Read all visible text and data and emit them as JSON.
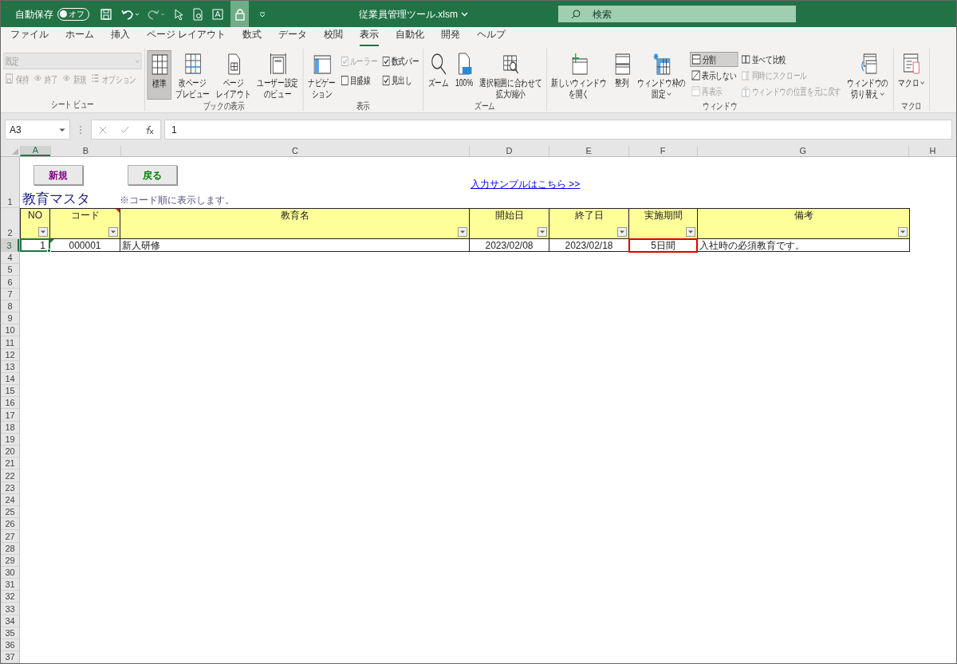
{
  "title_bar": {
    "autosave_label": "自動保存",
    "autosave_toggle": {
      "label": "オフ",
      "on": false
    },
    "filename": "従業員管理ツール.xlsm",
    "search": {
      "placeholder": "検索"
    }
  },
  "ribbon_tabs": [
    {
      "label": "ファイル",
      "selected": false
    },
    {
      "label": "ホーム",
      "selected": false
    },
    {
      "label": "挿入",
      "selected": false
    },
    {
      "label": "ページ レイアウト",
      "selected": false
    },
    {
      "label": "数式",
      "selected": false
    },
    {
      "label": "データ",
      "selected": false
    },
    {
      "label": "校閲",
      "selected": false
    },
    {
      "label": "表示",
      "selected": true
    },
    {
      "label": "自動化",
      "selected": false
    },
    {
      "label": "開発",
      "selected": false
    },
    {
      "label": "ヘルプ",
      "selected": false
    }
  ],
  "ribbon_groups": [
    {
      "label": "シート ビュー",
      "kind": "rows",
      "rows": [
        [
          {
            "kind": "dropdown",
            "value": "既定",
            "disabled": true
          }
        ],
        [
          {
            "kind": "small",
            "label": "保持",
            "disabled": true,
            "pressed": false
          },
          {
            "kind": "small",
            "label": "終了",
            "disabled": true,
            "pressed": false
          },
          {
            "kind": "small",
            "label": "新規",
            "disabled": true,
            "pressed": false
          },
          {
            "kind": "small",
            "label": "オプション",
            "disabled": true,
            "pressed": false
          }
        ]
      ]
    },
    {
      "label": "ブックの表示",
      "kind": "columns",
      "columns": [
        [
          {
            "kind": "large",
            "label_lines": [
              "標準"
            ],
            "pressed": true,
            "caret": false
          }
        ],
        [
          {
            "kind": "large",
            "label_lines": [
              "改ページ",
              "プレビュー"
            ],
            "pressed": false,
            "caret": false
          }
        ],
        [
          {
            "kind": "large",
            "label_lines": [
              "ページ",
              "レイアウト"
            ],
            "pressed": false,
            "caret": false
          }
        ],
        [
          {
            "kind": "large",
            "label_lines": [
              "ユーザー設定",
              "のビュー"
            ],
            "pressed": false,
            "caret": false
          }
        ]
      ]
    },
    {
      "label": "表示",
      "kind": "columns",
      "columns": [
        [
          {
            "kind": "large",
            "label_lines": [
              "ナビゲー",
              "ション"
            ],
            "pressed": false,
            "caret": false
          }
        ],
        [
          {
            "kind": "checkbox",
            "label": "ルーラー",
            "checked": true,
            "disabled": true
          },
          {
            "kind": "checkbox",
            "label": "目盛線",
            "checked": false,
            "disabled": false
          }
        ],
        [
          {
            "kind": "checkbox",
            "label": "数式バー",
            "checked": true,
            "disabled": false
          },
          {
            "kind": "checkbox",
            "label": "見出し",
            "checked": true,
            "disabled": false
          }
        ]
      ]
    },
    {
      "label": "ズーム",
      "kind": "columns",
      "columns": [
        [
          {
            "kind": "large",
            "label_lines": [
              "ズーム"
            ],
            "pressed": false,
            "caret": false
          }
        ],
        [
          {
            "kind": "large",
            "label_lines": [
              "100%"
            ],
            "pressed": false,
            "caret": false
          }
        ],
        [
          {
            "kind": "large",
            "label_lines": [
              "選択範囲に合わせて",
              "拡大/縮小"
            ],
            "pressed": false,
            "caret": false
          }
        ]
      ]
    },
    {
      "label": "ウィンドウ",
      "kind": "columns",
      "columns": [
        [
          {
            "kind": "large",
            "label_lines": [
              "新しいウィンドウ",
              "を開く"
            ],
            "pressed": false,
            "caret": false
          }
        ],
        [
          {
            "kind": "large",
            "label_lines": [
              "整列"
            ],
            "pressed": false,
            "caret": false
          }
        ],
        [
          {
            "kind": "large",
            "label_lines": [
              "ウィンドウ枠の",
              "固定"
            ],
            "pressed": false,
            "caret": true
          }
        ],
        [
          {
            "kind": "small",
            "label": "分割",
            "disabled": false,
            "pressed": true
          },
          {
            "kind": "small",
            "label": "表示しない",
            "disabled": false,
            "pressed": false
          },
          {
            "kind": "small",
            "label": "再表示",
            "disabled": true,
            "pressed": false
          }
        ],
        [
          {
            "kind": "small",
            "label": "並べて比較",
            "disabled": false,
            "pressed": false
          },
          {
            "kind": "small",
            "label": "同時にスクロール",
            "disabled": true,
            "pressed": false
          },
          {
            "kind": "small",
            "label": "ウィンドウの位置を元に戻す",
            "disabled": true,
            "pressed": false
          }
        ],
        [
          {
            "kind": "large",
            "label_lines": [
              "ウィンドウの",
              "切り替え"
            ],
            "pressed": false,
            "caret": true
          }
        ]
      ]
    },
    {
      "label": "マクロ",
      "kind": "columns",
      "columns": [
        [
          {
            "kind": "large",
            "label_lines": [
              "マクロ"
            ],
            "pressed": false,
            "caret": true
          }
        ]
      ]
    }
  ],
  "formula_bar": {
    "name_box": "A3",
    "formula": "1"
  },
  "column_headers": [
    {
      "label": "A",
      "selected": true
    },
    {
      "label": "B",
      "selected": false
    },
    {
      "label": "C",
      "selected": false
    },
    {
      "label": "D",
      "selected": false
    },
    {
      "label": "E",
      "selected": false
    },
    {
      "label": "F",
      "selected": false
    },
    {
      "label": "G",
      "selected": false
    },
    {
      "label": "H",
      "selected": false
    }
  ],
  "row_numbers": [
    {
      "label": "1",
      "selected": false
    },
    {
      "label": "2",
      "selected": false
    },
    {
      "label": "3",
      "selected": true
    },
    {
      "label": "4",
      "selected": false
    },
    {
      "label": "5",
      "selected": false
    },
    {
      "label": "6",
      "selected": false
    },
    {
      "label": "7",
      "selected": false
    },
    {
      "label": "8",
      "selected": false
    },
    {
      "label": "9",
      "selected": false
    },
    {
      "label": "10",
      "selected": false
    },
    {
      "label": "11",
      "selected": false
    },
    {
      "label": "12",
      "selected": false
    },
    {
      "label": "13",
      "selected": false
    },
    {
      "label": "14",
      "selected": false
    },
    {
      "label": "15",
      "selected": false
    },
    {
      "label": "16",
      "selected": false
    },
    {
      "label": "17",
      "selected": false
    },
    {
      "label": "18",
      "selected": false
    },
    {
      "label": "19",
      "selected": false
    },
    {
      "label": "20",
      "selected": false
    },
    {
      "label": "21",
      "selected": false
    },
    {
      "label": "22",
      "selected": false
    },
    {
      "label": "23",
      "selected": false
    },
    {
      "label": "24",
      "selected": false
    },
    {
      "label": "25",
      "selected": false
    },
    {
      "label": "26",
      "selected": false
    },
    {
      "label": "27",
      "selected": false
    },
    {
      "label": "28",
      "selected": false
    },
    {
      "label": "29",
      "selected": false
    },
    {
      "label": "30",
      "selected": false
    },
    {
      "label": "31",
      "selected": false
    },
    {
      "label": "32",
      "selected": false
    },
    {
      "label": "33",
      "selected": false
    },
    {
      "label": "34",
      "selected": false
    },
    {
      "label": "35",
      "selected": false
    },
    {
      "label": "36",
      "selected": false
    },
    {
      "label": "37",
      "selected": false
    }
  ],
  "sheet": {
    "buttons": [
      {
        "label": "新規",
        "color": "#800080"
      },
      {
        "label": "戻る",
        "color": "#008000"
      }
    ],
    "link": "入力サンプルはこちら >>",
    "title": "教育マスタ",
    "note": "※コード順に表示します。",
    "table": {
      "headers": [
        {
          "label": "NO",
          "comment": false
        },
        {
          "label": "コード",
          "comment": true
        },
        {
          "label": "教育名",
          "comment": false
        },
        {
          "label": "開始日",
          "comment": false
        },
        {
          "label": "終了日",
          "comment": false
        },
        {
          "label": "実施期間",
          "comment": false
        },
        {
          "label": "備考",
          "comment": false
        }
      ],
      "rows": [
        [
          {
            "text": "1",
            "selected": true,
            "flagged": false,
            "outlined": false
          },
          {
            "text": "000001",
            "selected": false,
            "flagged": true,
            "outlined": false
          },
          {
            "text": "新人研修",
            "selected": false,
            "flagged": false,
            "outlined": false
          },
          {
            "text": "2023/02/08",
            "selected": false,
            "flagged": false,
            "outlined": false
          },
          {
            "text": "2023/02/18",
            "selected": false,
            "flagged": false,
            "outlined": false
          },
          {
            "text": "5日間",
            "selected": false,
            "flagged": false,
            "outlined": true
          },
          {
            "text": "入社時の必須教育です。",
            "selected": false,
            "flagged": false,
            "outlined": false
          }
        ]
      ]
    }
  }
}
